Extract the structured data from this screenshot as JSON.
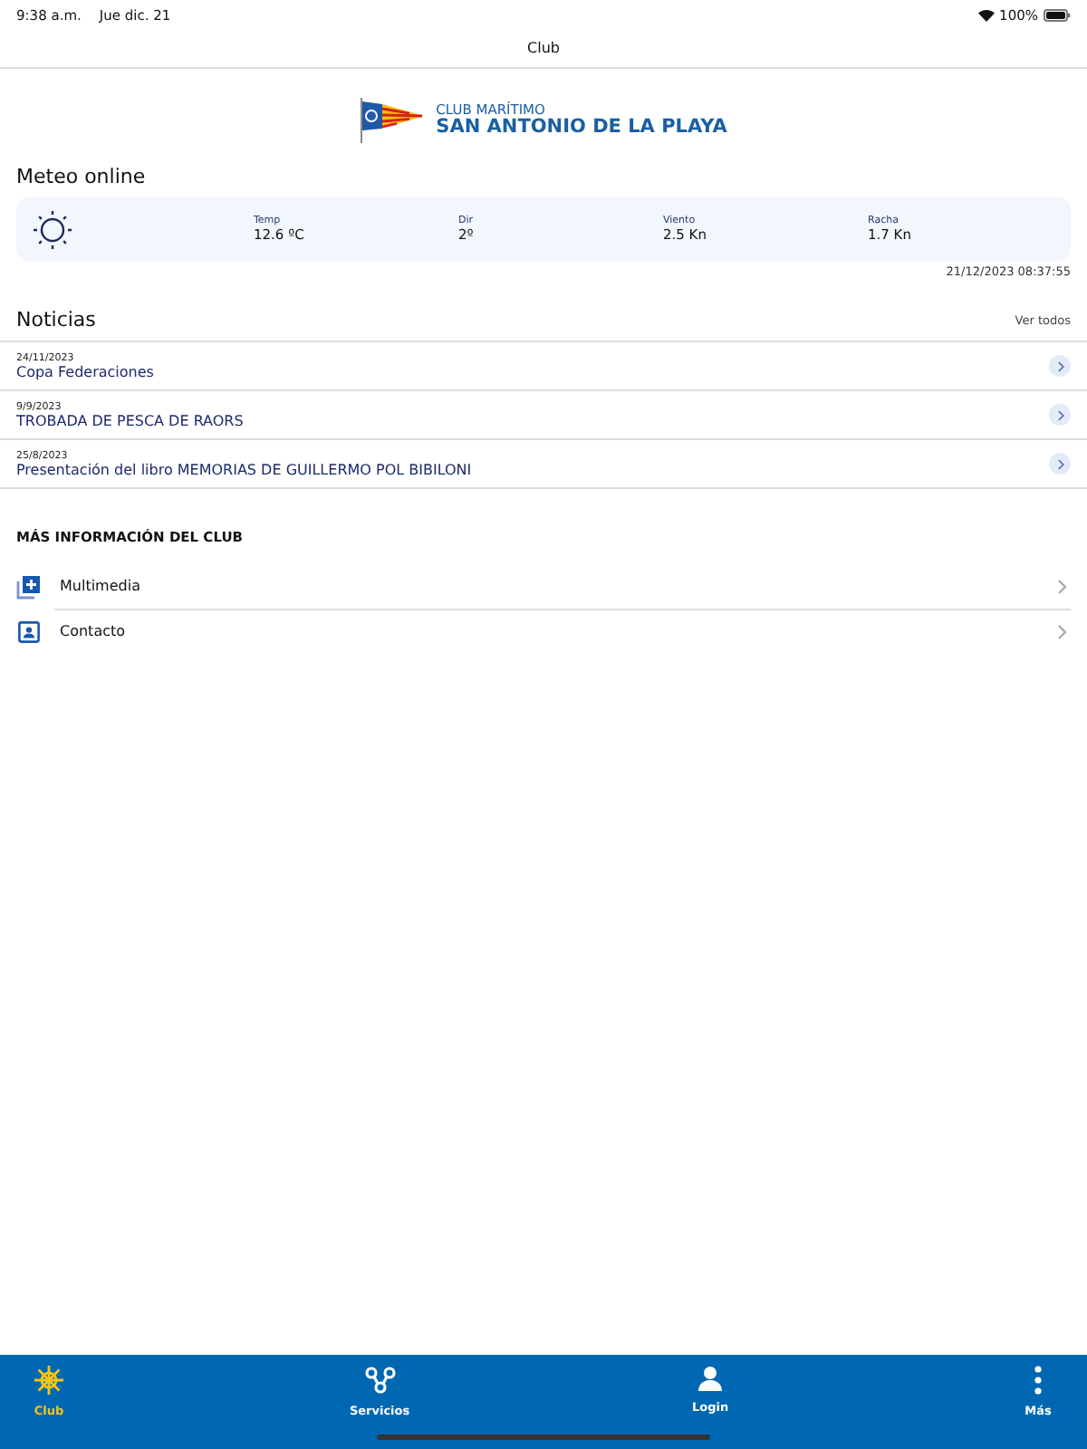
{
  "status_bar": {
    "time": "9:38 a.m.",
    "date": "Jue dic. 21",
    "battery": "100%"
  },
  "nav_bar": {
    "title": "Club"
  },
  "logo": {
    "line_1": "CLUB MARÍTIMO",
    "line_2": "SAN ANTONIO DE LA PLAYA"
  },
  "meteo": {
    "title": "Meteo online",
    "readings": [
      {
        "label": "Temp",
        "value": "12.6 ºC"
      },
      {
        "label": "Dir",
        "value": "2º"
      },
      {
        "label": "Viento",
        "value": "2.5 Kn"
      },
      {
        "label": "Racha",
        "value": "1.7 Kn"
      }
    ],
    "timestamp": "21/12/2023 08:37:55"
  },
  "news": {
    "title": "Noticias",
    "see_all": "Ver todos",
    "items": [
      {
        "date": "24/11/2023",
        "title": "Copa Federaciones"
      },
      {
        "date": "9/9/2023",
        "title": "TROBADA DE PESCA DE RAORS"
      },
      {
        "date": "25/8/2023",
        "title": "Presentación del libro MEMORIAS DE GUILLERMO POL BIBILONI"
      }
    ]
  },
  "more_info": {
    "title": "MÁS INFORMACIÓN DEL CLUB",
    "items": [
      {
        "label": "Multimedia"
      },
      {
        "label": "Contacto"
      }
    ]
  },
  "tab_bar": [
    {
      "label": "Club",
      "selected": true
    },
    {
      "label": "Servicios",
      "selected": false
    },
    {
      "label": "Login",
      "selected": false
    },
    {
      "label": "Más",
      "selected": false
    }
  ]
}
